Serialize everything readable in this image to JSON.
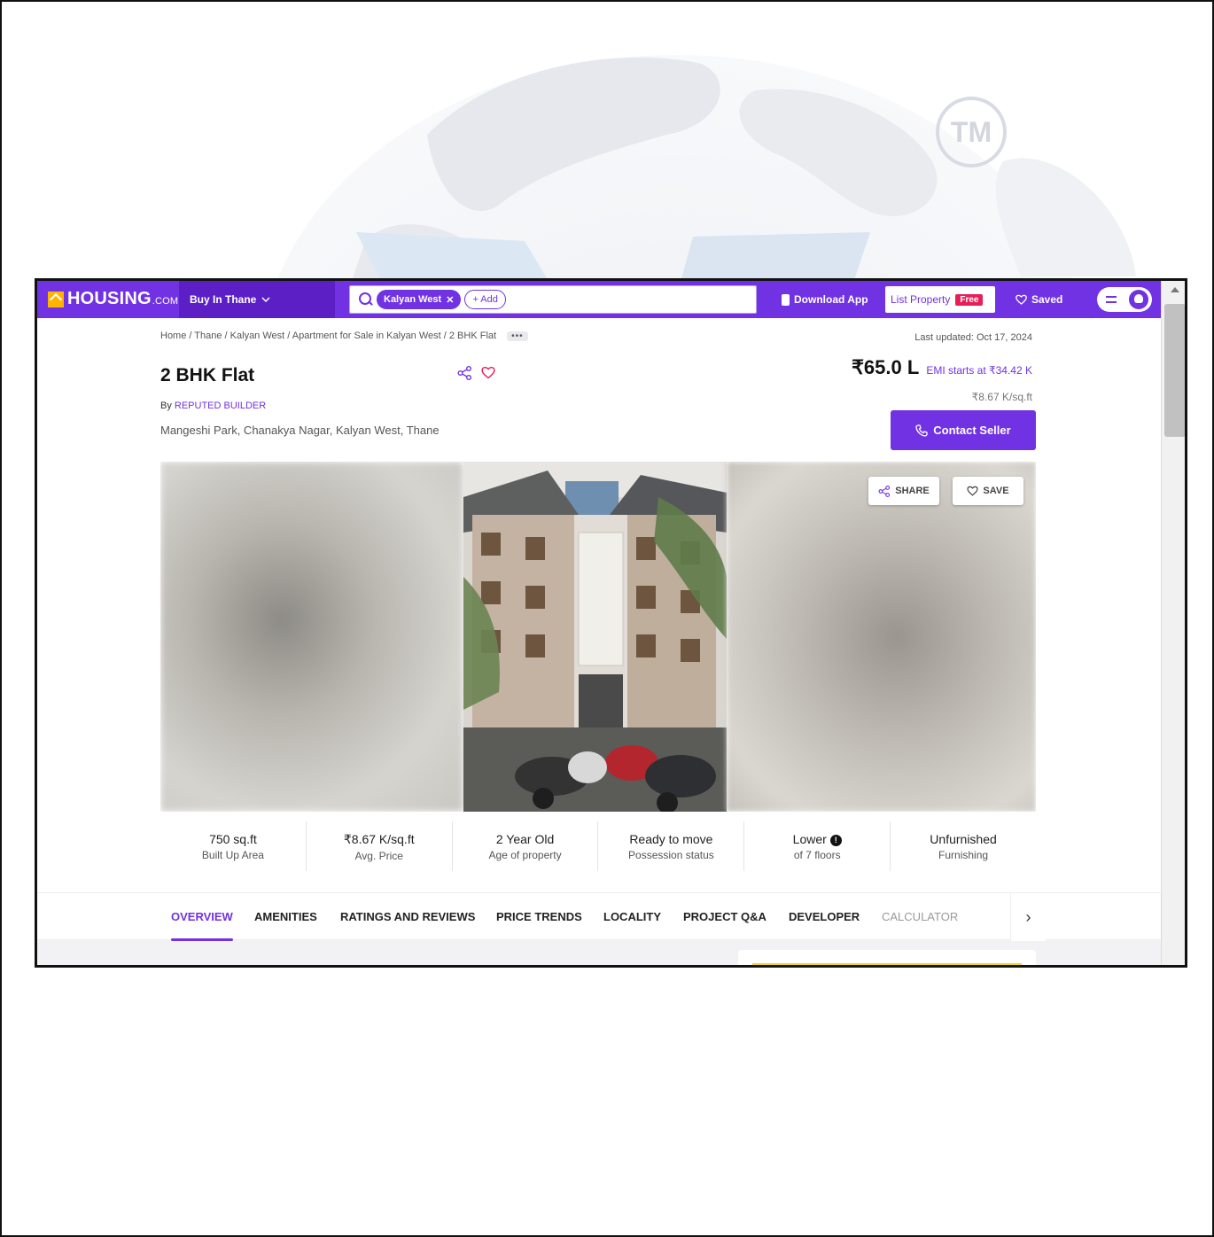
{
  "header": {
    "logo_text": "HOUSING",
    "logo_suffix": ".COM",
    "city_label": "Buy In Thane",
    "search_chip": "Kalyan West",
    "add_chip": "+ Add",
    "download_app": "Download App",
    "list_property": "List Property",
    "free_badge": "Free",
    "saved": "Saved"
  },
  "breadcrumb": {
    "text": "Home / Thane / Kalyan West / Apartment for Sale in Kalyan West / 2 BHK Flat",
    "more": "•••"
  },
  "listing": {
    "last_updated": "Last updated: Oct 17, 2024",
    "title": "2 BHK Flat",
    "builder_prefix": "By",
    "builder": "REPUTED BUILDER",
    "address": "Mangeshi Park, Chanakya Nagar, Kalyan West, Thane",
    "price": "₹65.0 L",
    "emi": "EMI starts at ₹34.42 K",
    "per_sqft": "₹8.67 K/sq.ft",
    "contact_button": "Contact Seller"
  },
  "gallery": {
    "share": "SHARE",
    "save": "SAVE"
  },
  "stats": [
    {
      "value": "750 sq.ft",
      "label": "Built Up Area"
    },
    {
      "value": "₹8.67 K/sq.ft",
      "label": "Avg. Price"
    },
    {
      "value": "2 Year Old",
      "label": "Age of property"
    },
    {
      "value": "Ready to move",
      "label": "Possession status"
    },
    {
      "value": "Lower",
      "label": "of 7 floors"
    },
    {
      "value": "Unfurnished",
      "label": "Furnishing"
    }
  ],
  "tabs": [
    "OVERVIEW",
    "AMENITIES",
    "RATINGS AND REVIEWS",
    "PRICE TRENDS",
    "LOCALITY",
    "PROJECT Q&A",
    "DEVELOPER",
    "CALCULATOR"
  ],
  "watermark": {
    "tm": "TM"
  },
  "colors": {
    "brand": "#7132e3",
    "accent": "#e61f5a",
    "logo": "#ffb400"
  }
}
